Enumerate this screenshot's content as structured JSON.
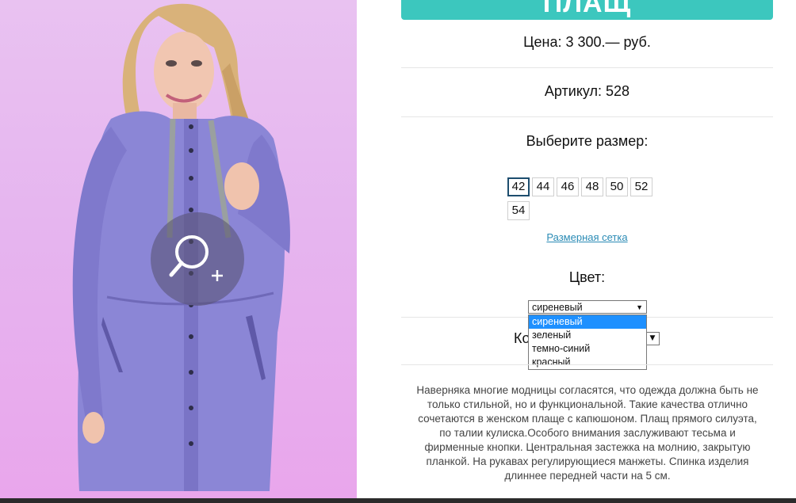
{
  "product": {
    "title": "ПЛАЩ",
    "price": "Цена: 3 300.— руб.",
    "article": "Артикул: 528",
    "size_prompt": "Выберите размер:",
    "sizes": [
      "42",
      "44",
      "46",
      "48",
      "50",
      "52",
      "54"
    ],
    "selected_size": "42",
    "size_chart_link": "Размерная сетка",
    "color_label": "Цвет:",
    "color_selected": "сиреневый",
    "color_options": [
      "сиреневый",
      "зеленый",
      "темно-синий",
      "красный"
    ],
    "quantity_label_partial": "Ко",
    "description": "Наверняка многие модницы согласятся, что одежда должна быть не только стильной, но и функциональной. Такие качества отлично сочетаются в женском плаще с капюшоном. Плащ прямого силуэта, по талии кулиска.Особого внимания заслуживают тесьма и фирменные кнопки. Центральная застежка на молнию, закрытую планкой. На рукавах регулирующиеся манжеты. Спинка изделия длиннее передней части на 5 см."
  },
  "icons": {
    "zoom": "zoom-in-icon",
    "dropdown_arrow": "▼"
  },
  "colors": {
    "accent": "#3cc7be",
    "link": "#2a8bb5",
    "highlight": "#1e90ff",
    "coat": "#8b86d6",
    "background_photo": "#e8b8ef"
  }
}
